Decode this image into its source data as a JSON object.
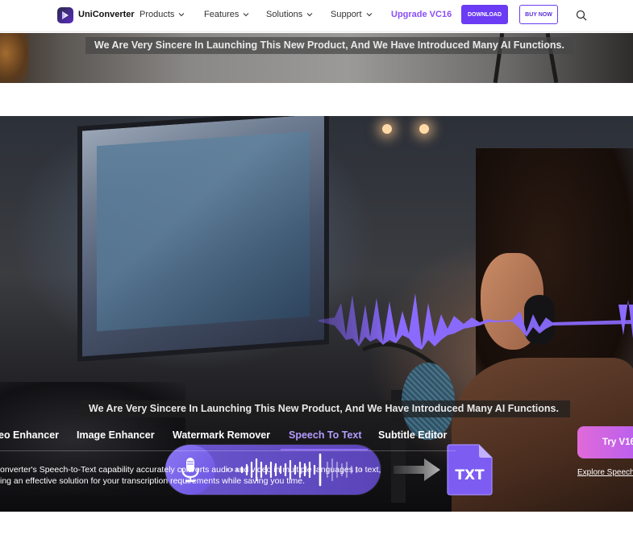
{
  "colors": {
    "accent": "#6b3cf3",
    "upgrade": "#8a4ff7",
    "active_tab": "#b39dff",
    "try_gradient_start": "#e06ad8",
    "try_gradient_end": "#b25cf3"
  },
  "nav": {
    "brand": "UniConverter",
    "menu": [
      "Products",
      "Features",
      "Solutions",
      "Support"
    ],
    "upgrade": "Upgrade VC16",
    "download": "DOWNLOAD",
    "buy_now": "BUY NOW",
    "icons": {
      "logo": "uniconverter-logo-icon",
      "search": "search-icon",
      "chevron": "chevron-down-icon"
    }
  },
  "top_strip": {
    "caption": "We Are Very Sincere In Launching This New Product, And We Have Introduced Many AI Functions."
  },
  "hero": {
    "caption": "We Are Very Sincere In Launching This New Product, And We Have Introduced Many AI Functions.",
    "file_label": "TXT",
    "tabs": [
      "eo Enhancer",
      "Image Enhancer",
      "Watermark Remover",
      "Speech To Text",
      "Subtitle Editor"
    ],
    "active_tab_index": 3,
    "description_line1": "onverter's Speech-to-Text capability accurately converts audio and video in multiple languages to text,",
    "description_line2": "ing an effective solution for your transcription requirements while saving you time.",
    "try_button": "Try V16",
    "explore_link": "Explore Speech"
  }
}
